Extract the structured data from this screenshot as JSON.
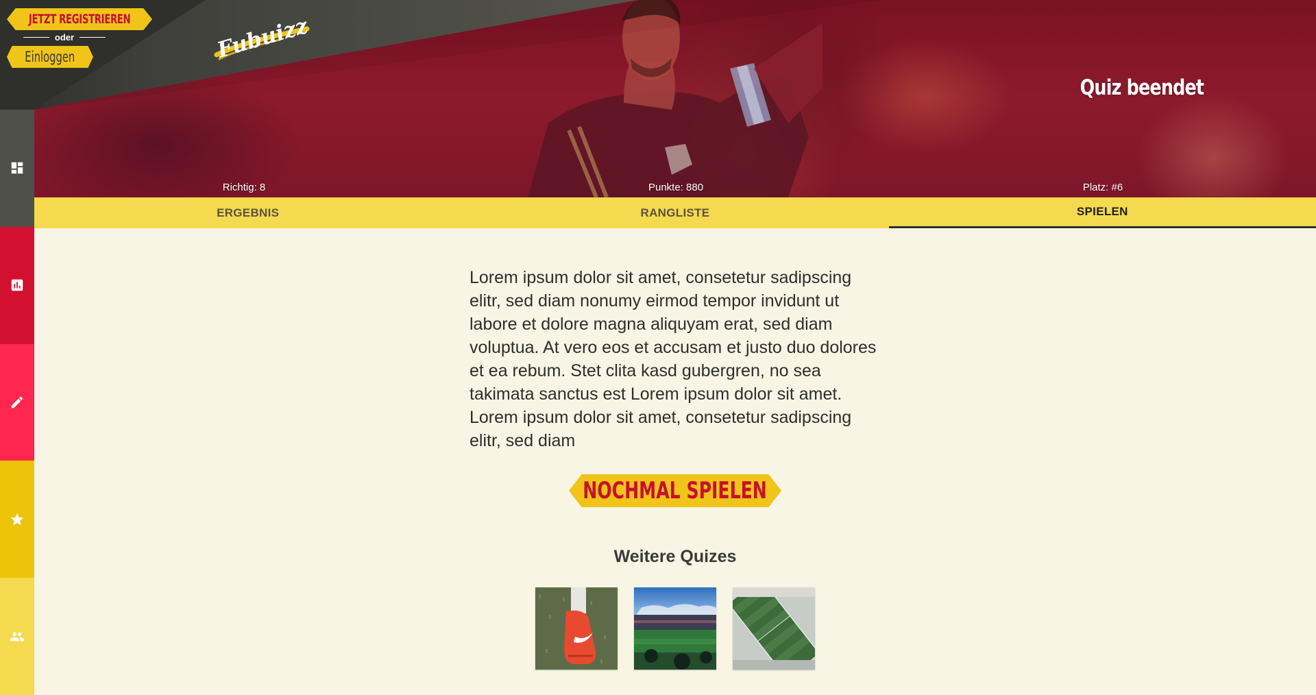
{
  "header": {
    "register_label": "JETZT REGISTRIEREN",
    "or_label": "oder",
    "login_label": "Einloggen",
    "logo_text": "Fubuizz",
    "title": "Quiz beendet"
  },
  "stats": {
    "correct": "Richtig: 8",
    "points": "Punkte: 880",
    "rank": "Platz: #6"
  },
  "tabs": [
    {
      "label": "ERGEBNIS",
      "active": false
    },
    {
      "label": "RANGLISTE",
      "active": false
    },
    {
      "label": "SPIELEN",
      "active": true
    }
  ],
  "sidebar": {
    "items": [
      {
        "icon": "dashboard-icon",
        "color": "#4f4f49"
      },
      {
        "icon": "bar-chart-icon",
        "color": "#d2102f"
      },
      {
        "icon": "pencil-icon",
        "color": "#ff2650"
      },
      {
        "icon": "star-icon",
        "color": "#ebc40a"
      },
      {
        "icon": "people-icon",
        "color": "#f5d94e"
      }
    ]
  },
  "main": {
    "description": "Lorem ipsum dolor sit amet, consetetur sadipscing elitr, sed diam nonumy eirmod tempor invidunt ut labore et dolore magna aliquyam erat, sed diam voluptua. At vero eos et accusam et justo duo dolores et ea rebum. Stet clita kasd gubergren, no sea takimata sanctus est Lorem ipsum dolor sit amet. Lorem ipsum dolor sit amet, consetetur sadipscing elitr, sed diam",
    "play_again_label": "NOCHMAL SPIELEN",
    "more_quizzes_title": "Weitere Quizes",
    "thumbnails": [
      "football-boot-thumbnail",
      "stadium-crowd-thumbnail",
      "aerial-pitch-thumbnail"
    ]
  },
  "colors": {
    "accent_yellow": "#f0c419",
    "accent_red": "#c8102e",
    "tab_bar": "#f5d94e",
    "background": "#f8f5e4",
    "banner_dark": "#2f302c"
  }
}
